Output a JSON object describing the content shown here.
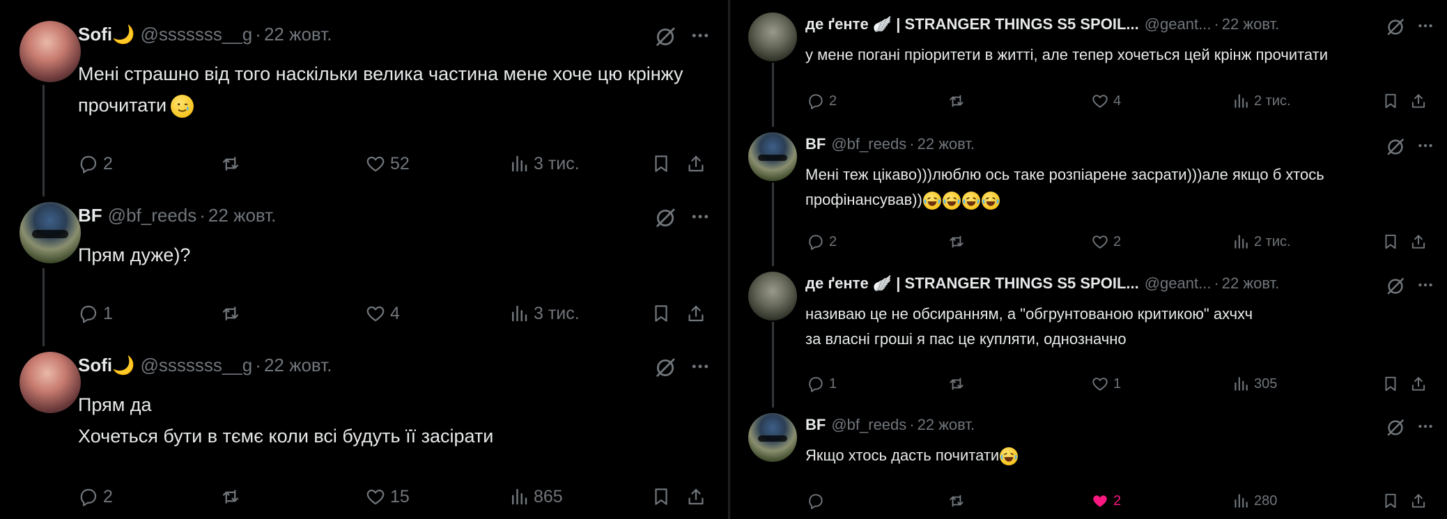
{
  "stat_labels": {
    "reply": "Відповісти",
    "retweet": "Репост",
    "like": "Подобається",
    "views": "Перегляди"
  },
  "left": [
    {
      "name": "Sofi",
      "name_emoji": "🌙",
      "handle": "@sssssss__g",
      "date": "22 жовт.",
      "lines": [
        "Мені страшно від того наскільки велика частина мене хоче цю крінжу",
        "прочитати"
      ],
      "trailing_emoji": "🥲",
      "replies": "2",
      "retweets": "",
      "likes": "52",
      "views": "3 тис."
    },
    {
      "name": "BF",
      "name_emoji": "",
      "handle": "@bf_reeds",
      "date": "22 жовт.",
      "lines": [
        "Прям дуже)?"
      ],
      "replies": "1",
      "retweets": "",
      "likes": "4",
      "views": "3 тис."
    },
    {
      "name": "Sofi",
      "name_emoji": "🌙",
      "handle": "@sssssss__g",
      "date": "22 жовт.",
      "lines": [
        "Прям да",
        "Хочеться бути в тємє коли всі будуть її засірати"
      ],
      "replies": "2",
      "retweets": "",
      "likes": "15",
      "views": "865"
    }
  ],
  "right": [
    {
      "name": "де ґенте 🪽 | STRANGER THINGS S5 SPOIL...",
      "handle": "@geant...",
      "date": "22 жовт.",
      "lines": [
        "у мене погані пріоритети в житті, але тепер хочеться цей крінж прочитати"
      ],
      "replies": "2",
      "retweets": "",
      "likes": "4",
      "views": "2 тис."
    },
    {
      "name": "BF",
      "handle": "@bf_reeds",
      "date": "22 жовт.",
      "lines": [
        "Мені теж цікаво)))люблю ось таке розпіарене засрати)))але якщо б хтось",
        "профінансував))"
      ],
      "laugh_count": 4,
      "replies": "2",
      "retweets": "",
      "likes": "2",
      "views": "2 тис."
    },
    {
      "name": "де ґенте 🪽 | STRANGER THINGS S5 SPOIL...",
      "handle": "@geant...",
      "date": "22 жовт.",
      "lines": [
        "називаю це не обсиранням, а \"обгрунтованою критикою\" ахчхч",
        "за власні гроші я пас це купляти, однозначно"
      ],
      "replies": "1",
      "retweets": "",
      "likes": "1",
      "views": "305"
    },
    {
      "name": "BF",
      "handle": "@bf_reeds",
      "date": "22 жовт.",
      "lines": [
        "Якщо хтось дасть почитати"
      ],
      "laugh_count": 1,
      "replies": "",
      "retweets": "",
      "likes": "2",
      "liked": true,
      "views": "280"
    }
  ],
  "colors": {
    "background": "#000000",
    "text": "#e7e9ea",
    "muted": "#71767b",
    "like_active": "#f91880",
    "thread_line": "#333639"
  },
  "icons": [
    "reply-icon",
    "retweet-icon",
    "like-icon",
    "views-icon",
    "bookmark-icon",
    "share-icon",
    "grok-icon",
    "more-icon"
  ]
}
